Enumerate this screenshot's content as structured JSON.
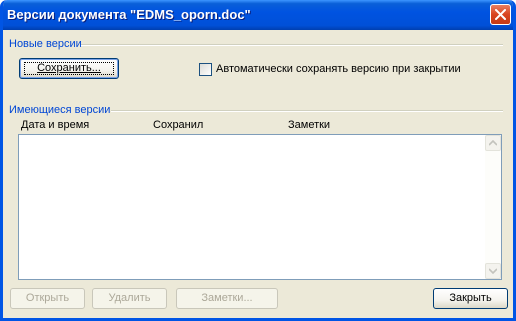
{
  "window": {
    "title": "Версии документа \"EDMS_oporn.doc\""
  },
  "new_versions": {
    "label": "Новые версии",
    "save_button": "Сохранить...",
    "auto_save_checkbox_label": "Автоматически сохранять версию при закрытии",
    "auto_save_checked": false
  },
  "existing_versions": {
    "label": "Имеющиеся версии",
    "columns": [
      "Дата и время",
      "Сохранил",
      "Заметки"
    ],
    "rows": []
  },
  "buttons": {
    "open": "Открыть",
    "delete": "Удалить",
    "notes": "Заметки...",
    "close": "Закрыть"
  },
  "icons": {
    "close": "close-icon",
    "scroll_up": "chevron-up-icon",
    "scroll_down": "chevron-down-icon"
  }
}
